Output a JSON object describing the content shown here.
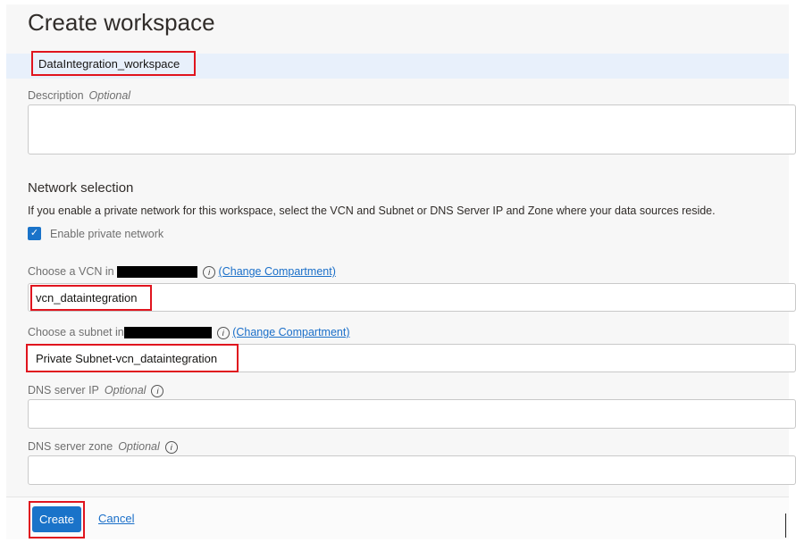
{
  "page": {
    "title": "Create workspace"
  },
  "form": {
    "name": {
      "value": "DataIntegration_workspace"
    },
    "description": {
      "label": "Description",
      "optional": "Optional",
      "value": ""
    },
    "network": {
      "heading": "Network selection",
      "help": "If you enable a private network for this workspace, select the VCN and Subnet or DNS Server IP and Zone where your data sources reside.",
      "checkbox_label": "Enable private network",
      "checked": true
    },
    "vcn": {
      "label": "Choose a VCN in",
      "link": "(Change Compartment)",
      "value": "vcn_dataintegration"
    },
    "subnet": {
      "label": "Choose a subnet in",
      "link": "(Change Compartment)",
      "value": "Private Subnet-vcn_dataintegration"
    },
    "dns_ip": {
      "label": "DNS server IP",
      "optional": "Optional",
      "value": ""
    },
    "dns_zone": {
      "label": "DNS server zone",
      "optional": "Optional",
      "value": ""
    }
  },
  "footer": {
    "create": "Create",
    "cancel": "Cancel"
  },
  "colors": {
    "primary": "#1a73c9",
    "highlight": "#e0141e",
    "link": "#1a6fc9"
  }
}
